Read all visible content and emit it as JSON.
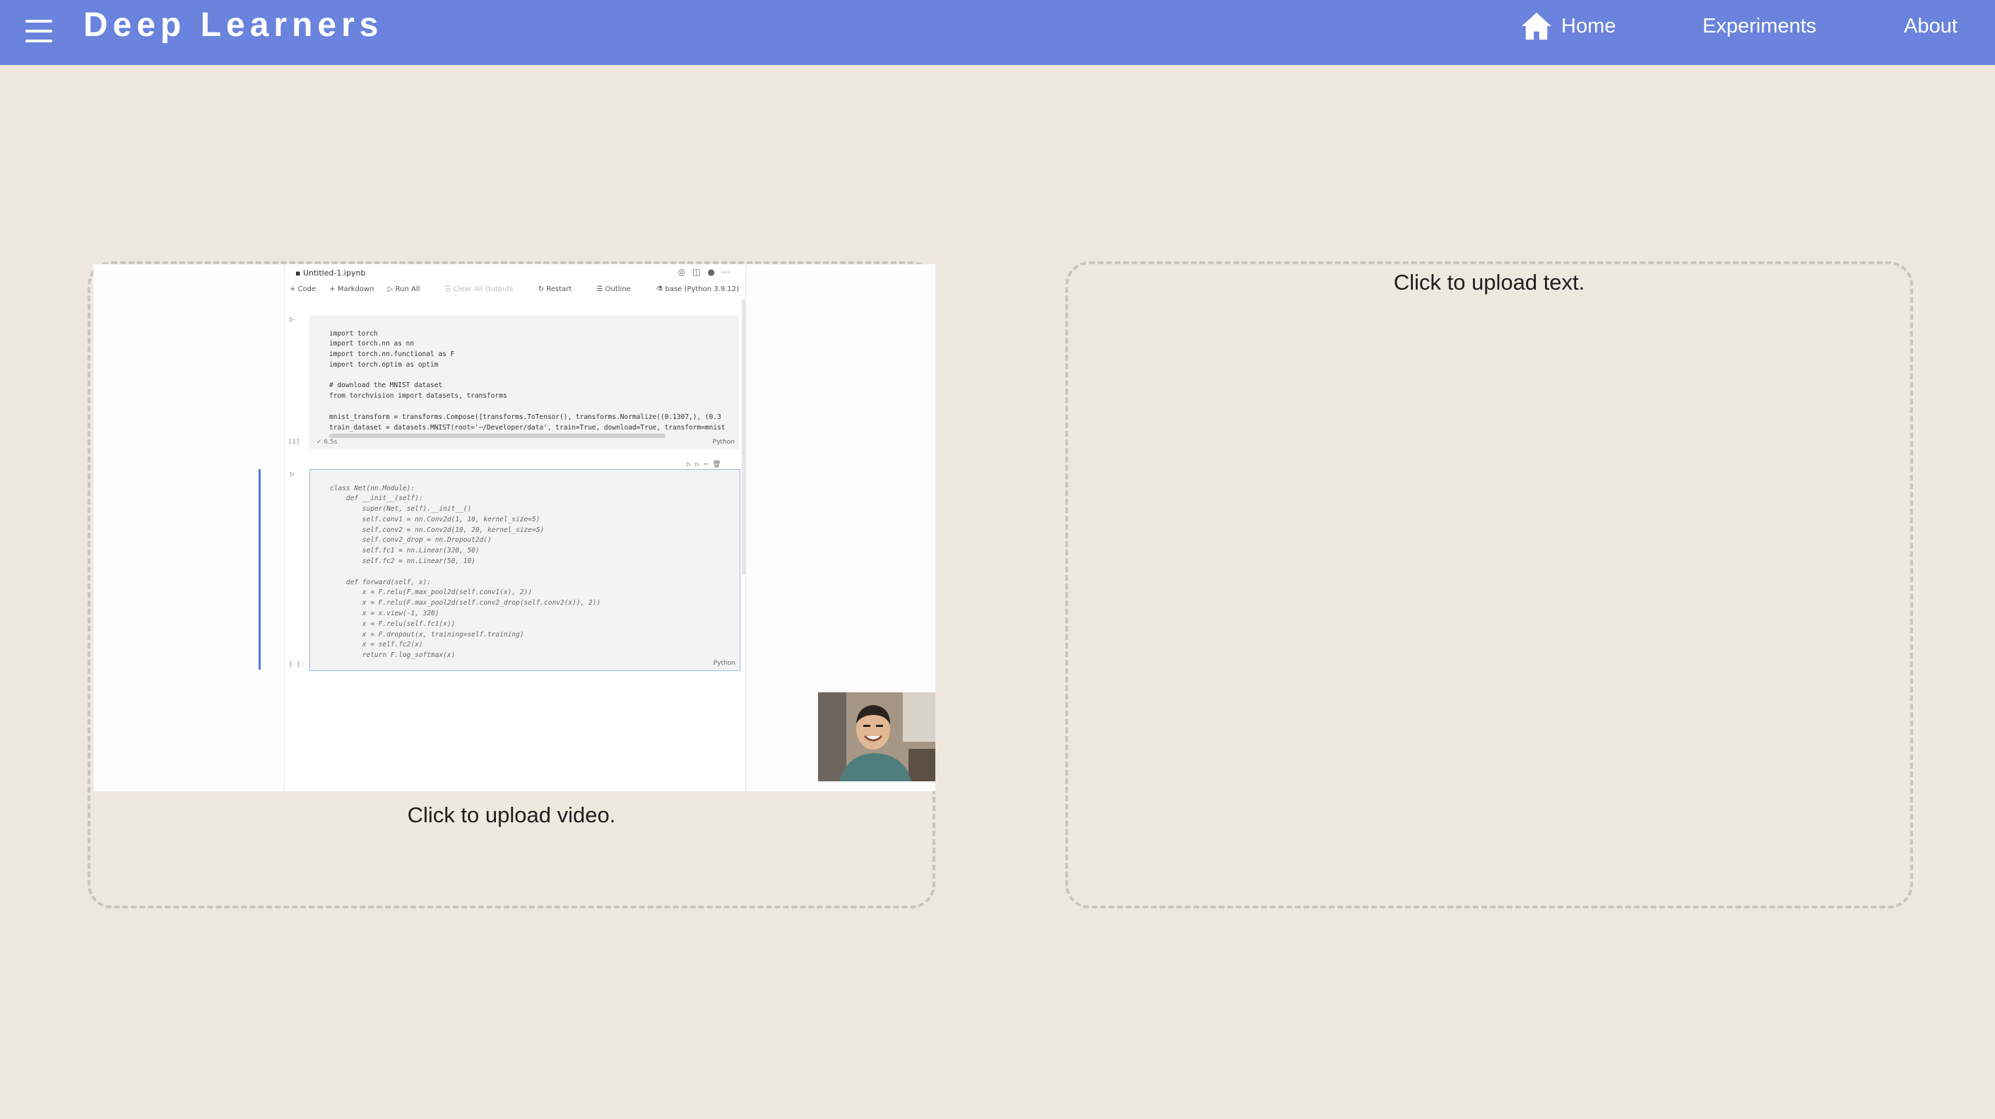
{
  "header": {
    "brand": "Deep Learners",
    "nav": {
      "home": "Home",
      "experiments": "Experiments",
      "about": "About"
    },
    "background_color": "#6a83dc"
  },
  "video_panel": {
    "label": "Click to upload video.",
    "notebook": {
      "tab_title": "Untitled-1.ipynb",
      "toolbar": [
        "+ Code",
        "+ Markdown",
        "Run All",
        "Clear All Outputs",
        "Restart",
        "Outline"
      ],
      "kernel": "base (Python 3.9.12)",
      "cells": [
        {
          "exec_count": "[1]",
          "time": "6.5s",
          "language": "Python",
          "code": "import torch\nimport torch.nn as nn\nimport torch.nn.functional as F\nimport torch.optim as optim\n\n# download the MNIST dataset\nfrom torchvision import datasets, transforms\n\nmnist_transform = transforms.Compose([transforms.ToTensor(), transforms.Normalize((0.1307,), (0.3\ntrain_dataset = datasets.MNIST(root='~/Developer/data', train=True, download=True, transform=mnist"
        },
        {
          "exec_count": "[ ]",
          "language": "Python",
          "code": "class Net(nn.Module):\n    def __init__(self):\n        super(Net, self).__init__()\n        self.conv1 = nn.Conv2d(1, 10, kernel_size=5)\n        self.conv2 = nn.Conv2d(10, 20, kernel_size=5)\n        self.conv2_drop = nn.Dropout2d()\n        self.fc1 = nn.Linear(320, 50)\n        self.fc2 = nn.Linear(50, 10)\n\n    def forward(self, x):\n        x = F.relu(F.max_pool2d(self.conv1(x), 2))\n        x = F.relu(F.max_pool2d(self.conv2_drop(self.conv2(x)), 2))\n        x = x.view(-1, 320)\n        x = F.relu(self.fc1(x))\n        x = F.dropout(x, training=self.training)\n        x = self.fc2(x)\n        return F.log_softmax(x)"
        }
      ]
    }
  },
  "text_panel": {
    "label": "Click to upload text."
  }
}
